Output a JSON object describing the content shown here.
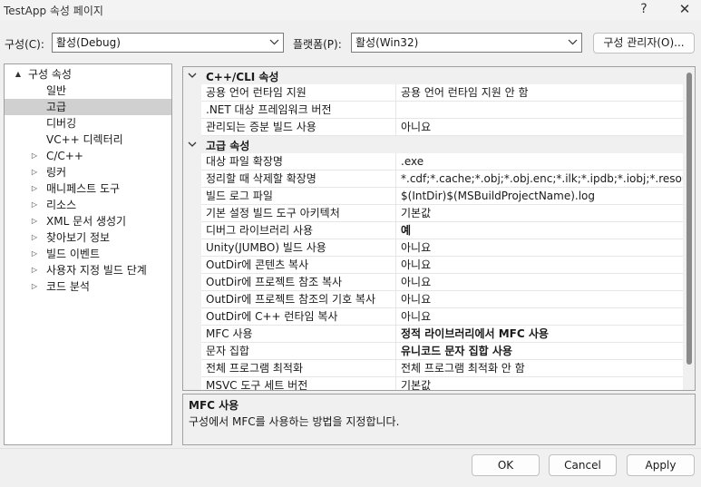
{
  "window": {
    "title": "TestApp 속성 페이지",
    "help_glyph": "?",
    "close_glyph": "✕"
  },
  "toolbar": {
    "config_label": "구성(C):",
    "config_value": "활성(Debug)",
    "platform_label": "플랫폼(P):",
    "platform_value": "활성(Win32)",
    "config_manager_label": "구성 관리자(O)..."
  },
  "tree": {
    "items": [
      {
        "label": "구성 속성",
        "twisty": "▲"
      },
      {
        "label": "일반",
        "twisty": ""
      },
      {
        "label": "고급",
        "twisty": "",
        "selected": true
      },
      {
        "label": "디버깅",
        "twisty": ""
      },
      {
        "label": "VC++ 디렉터리",
        "twisty": ""
      },
      {
        "label": "C/C++",
        "twisty": "▷"
      },
      {
        "label": "링커",
        "twisty": "▷"
      },
      {
        "label": "매니페스트 도구",
        "twisty": "▷"
      },
      {
        "label": "리소스",
        "twisty": "▷"
      },
      {
        "label": "XML 문서 생성기",
        "twisty": "▷"
      },
      {
        "label": "찾아보기 정보",
        "twisty": "▷"
      },
      {
        "label": "빌드 이벤트",
        "twisty": "▷"
      },
      {
        "label": "사용자 지정 빌드 단계",
        "twisty": "▷"
      },
      {
        "label": "코드 분석",
        "twisty": "▷"
      }
    ]
  },
  "grid": {
    "categories": [
      {
        "label": "C++/CLI 속성",
        "props": [
          {
            "name": "공용 언어 런타임 지원",
            "value": "공용 언어 런타임 지원 안 함",
            "bold": false
          },
          {
            "name": ".NET 대상 프레임워크 버전",
            "value": "",
            "bold": false
          },
          {
            "name": "관리되는 증분 빌드 사용",
            "value": "아니요",
            "bold": false
          }
        ]
      },
      {
        "label": "고급 속성",
        "props": [
          {
            "name": "대상 파일 확장명",
            "value": ".exe",
            "bold": false
          },
          {
            "name": "정리할 때 삭제할 확장명",
            "value": "*.cdf;*.cache;*.obj;*.obj.enc;*.ilk;*.ipdb;*.iobj;*.resources;*.tl",
            "bold": false
          },
          {
            "name": "빌드 로그 파일",
            "value": "$(IntDir)$(MSBuildProjectName).log",
            "bold": false
          },
          {
            "name": "기본 설정 빌드 도구 아키텍처",
            "value": "기본값",
            "bold": false
          },
          {
            "name": "디버그 라이브러리 사용",
            "value": "예",
            "bold": true
          },
          {
            "name": "Unity(JUMBO) 빌드 사용",
            "value": "아니요",
            "bold": false
          },
          {
            "name": "OutDir에 콘텐츠 복사",
            "value": "아니요",
            "bold": false
          },
          {
            "name": "OutDir에 프로젝트 참조 복사",
            "value": "아니요",
            "bold": false
          },
          {
            "name": "OutDir에 프로젝트 참조의 기호 복사",
            "value": "아니요",
            "bold": false
          },
          {
            "name": "OutDir에 C++ 런타임 복사",
            "value": "아니요",
            "bold": false
          },
          {
            "name": "MFC 사용",
            "value": "정적 라이브러리에서 MFC 사용",
            "bold": true
          },
          {
            "name": "문자 집합",
            "value": "유니코드 문자 집합 사용",
            "bold": true
          },
          {
            "name": "전체 프로그램 최적화",
            "value": "전체 프로그램 최적화 안 함",
            "bold": false
          },
          {
            "name": "MSVC 도구 세트 버전",
            "value": "기본값",
            "bold": false
          }
        ]
      }
    ]
  },
  "description": {
    "title": "MFC 사용",
    "text": "구성에서 MFC를 사용하는 방법을 지정합니다."
  },
  "buttons": {
    "ok": "OK",
    "cancel": "Cancel",
    "apply": "Apply"
  }
}
